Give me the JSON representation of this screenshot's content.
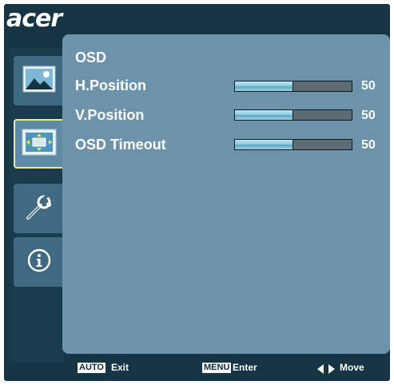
{
  "brand": {
    "logo_text": "acer"
  },
  "menu": {
    "title": "OSD",
    "items": [
      {
        "label": "H.Position",
        "value": "50",
        "level": 0.5
      },
      {
        "label": "V.Position",
        "value": "50",
        "level": 0.5
      },
      {
        "label": "OSD Timeout",
        "value": "50",
        "level": 0.5
      }
    ]
  },
  "sidebar": {
    "items": [
      {
        "icon": "picture-icon",
        "active": false
      },
      {
        "icon": "position-icon",
        "active": true
      },
      {
        "icon": "settings-wrench-icon",
        "active": false
      },
      {
        "icon": "info-icon",
        "active": false
      }
    ]
  },
  "footer": {
    "auto_key": "AUTO",
    "auto_label": "Exit",
    "menu_key": "MENU",
    "menu_label": "Enter",
    "move_label": "Move"
  },
  "colors": {
    "frame": "#163544",
    "panel": "#6c93aa",
    "active_border": "#e6ec9a",
    "slider_fill": "#92cde0",
    "slider_track": "#5c6b74"
  }
}
